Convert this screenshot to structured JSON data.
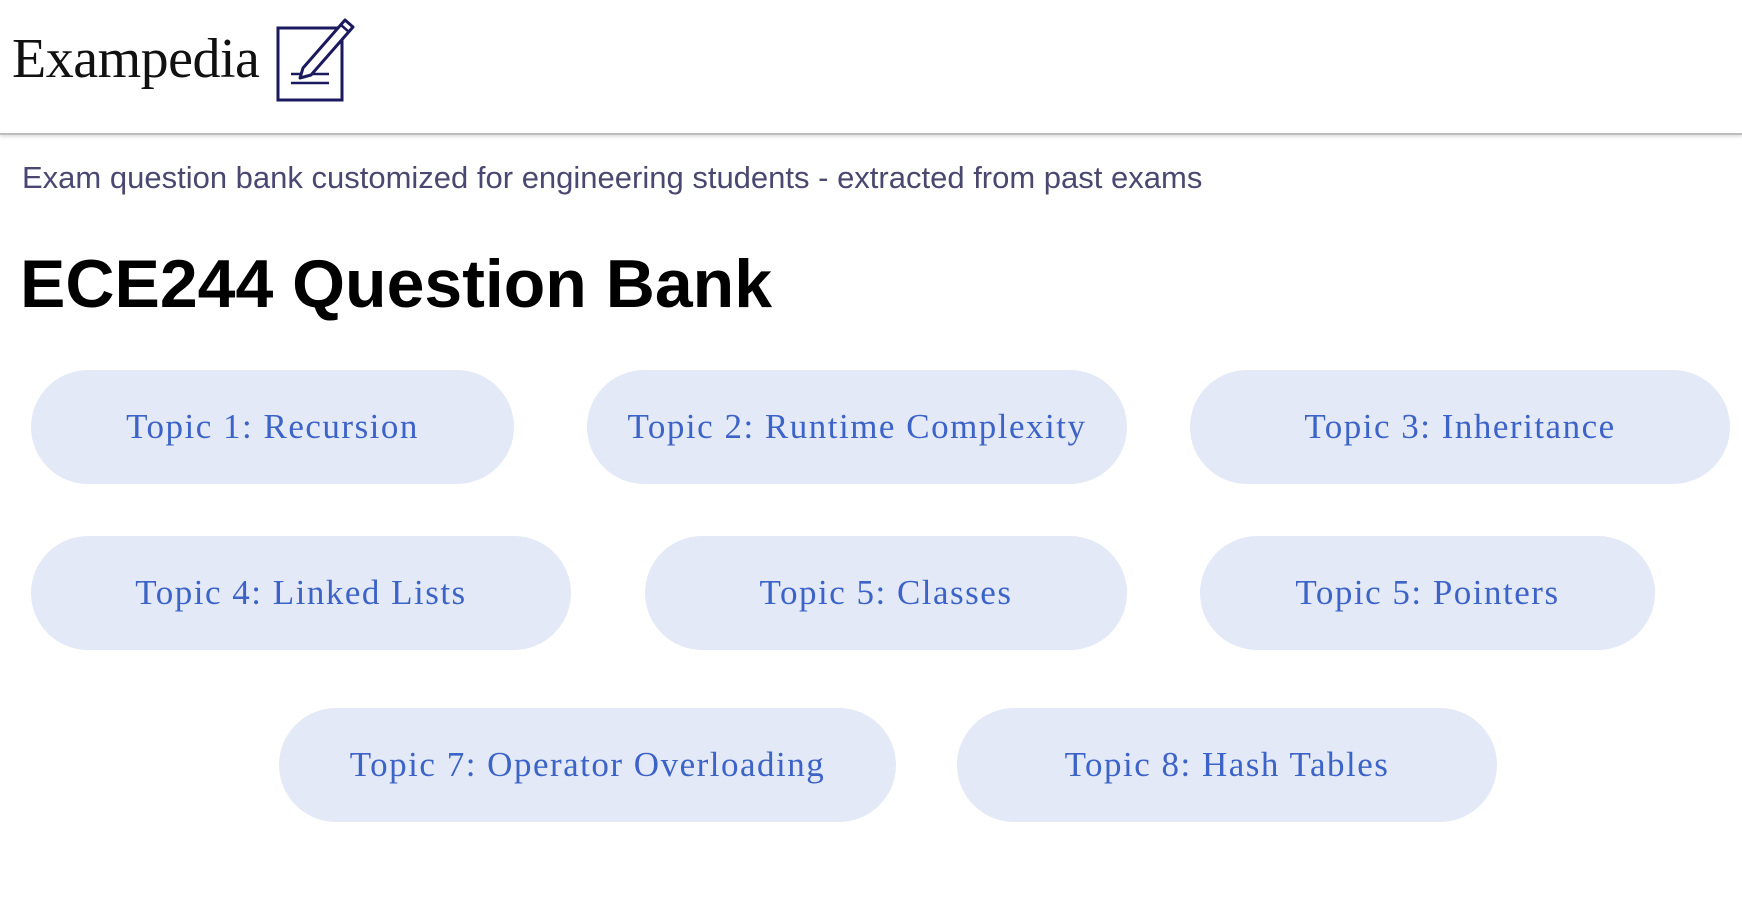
{
  "header": {
    "brand_name": "Exampedia",
    "brand_icon": "notepad-pen-icon",
    "brand_icon_color": "#1c1a5e"
  },
  "tagline": "Exam question bank customized for engineering students - extracted from past exams",
  "page_title": "ECE244 Question Bank",
  "topics": [
    {
      "label": "Topic 1: Recursion"
    },
    {
      "label": "Topic 2: Runtime Complexity"
    },
    {
      "label": "Topic 3: Inheritance"
    },
    {
      "label": "Topic 4: Linked Lists"
    },
    {
      "label": "Topic 5: Classes"
    },
    {
      "label": "Topic 5: Pointers"
    },
    {
      "label": "Topic 7: Operator Overloading"
    },
    {
      "label": "Topic 8: Hash Tables"
    }
  ],
  "colors": {
    "topic_background": "#e4e9f7",
    "topic_text": "#3c63c7",
    "tagline_text": "#4a4870"
  }
}
